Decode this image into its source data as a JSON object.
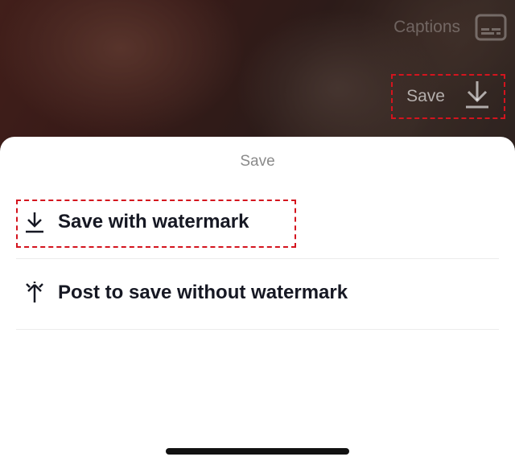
{
  "video": {
    "captions_label": "Captions",
    "save_label": "Save"
  },
  "sheet": {
    "title": "Save",
    "options": [
      {
        "label": "Save with watermark",
        "icon": "download-icon"
      },
      {
        "label": "Post to save without watermark",
        "icon": "spark-icon"
      }
    ]
  },
  "colors": {
    "highlight": "#d4141e",
    "text_primary": "#161823",
    "text_secondary": "#8a8a8a"
  }
}
